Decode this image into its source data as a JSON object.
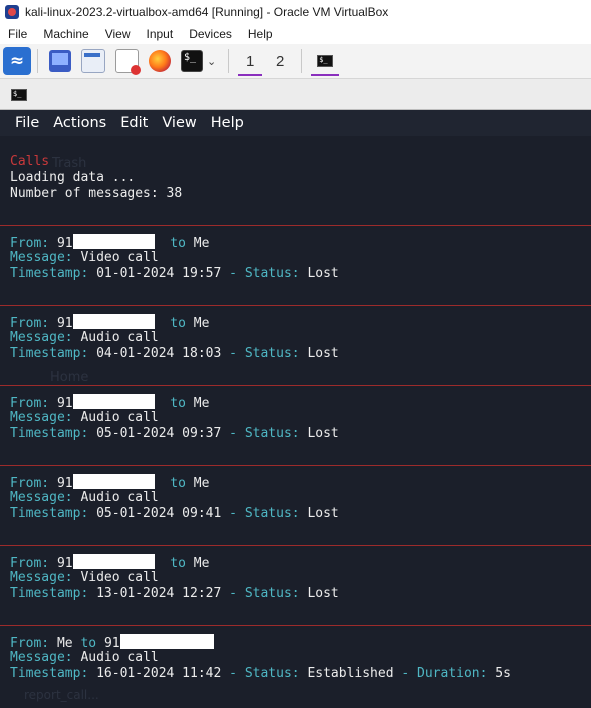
{
  "window": {
    "title": "kali-linux-2023.2-virtualbox-amd64 [Running] - Oracle VM VirtualBox"
  },
  "menubar": [
    "File",
    "Machine",
    "View",
    "Input",
    "Devices",
    "Help"
  ],
  "toolbar": {
    "kali_icon": "kali-dragon-icon",
    "workspaces": [
      "1",
      "2"
    ]
  },
  "terminal": {
    "menu": [
      "File",
      "Actions",
      "Edit",
      "View",
      "Help"
    ],
    "heading": "Calls",
    "loading": "Loading data ...",
    "count_line": "Number of messages: 38",
    "labels": {
      "from": "From:",
      "to": "to",
      "message": "Message:",
      "timestamp": "Timestamp:",
      "dash": " - ",
      "status": "Status:",
      "duration": "Duration:"
    },
    "records": [
      {
        "from": "91",
        "to": "Me",
        "message": "Video call",
        "timestamp": "01-01-2024 19:57",
        "status": "Lost"
      },
      {
        "from": "91",
        "to": "Me",
        "message": "Audio call",
        "timestamp": "04-01-2024 18:03",
        "status": "Lost"
      },
      {
        "from": "91",
        "to": "Me",
        "message": "Audio call",
        "timestamp": "05-01-2024 09:37",
        "status": "Lost"
      },
      {
        "from": "91",
        "to": "Me",
        "message": "Audio call",
        "timestamp": "05-01-2024 09:41",
        "status": "Lost"
      },
      {
        "from": "91",
        "to": "Me",
        "message": "Video call",
        "timestamp": "13-01-2024 12:27",
        "status": "Lost"
      },
      {
        "from": "Me",
        "to": "91",
        "message": "Audio call",
        "timestamp": "16-01-2024 11:42",
        "status": "Established",
        "duration": "5s"
      }
    ]
  },
  "background_labels": {
    "trash": "Trash",
    "home": "Home",
    "report": "report_call..."
  },
  "colors": {
    "terminal_bg": "#1b1f2a",
    "separator": "#9c2b2b",
    "label_teal": "#4fb7c4",
    "heading_red": "#c8393b",
    "workspace_accent": "#8a2fbd"
  }
}
